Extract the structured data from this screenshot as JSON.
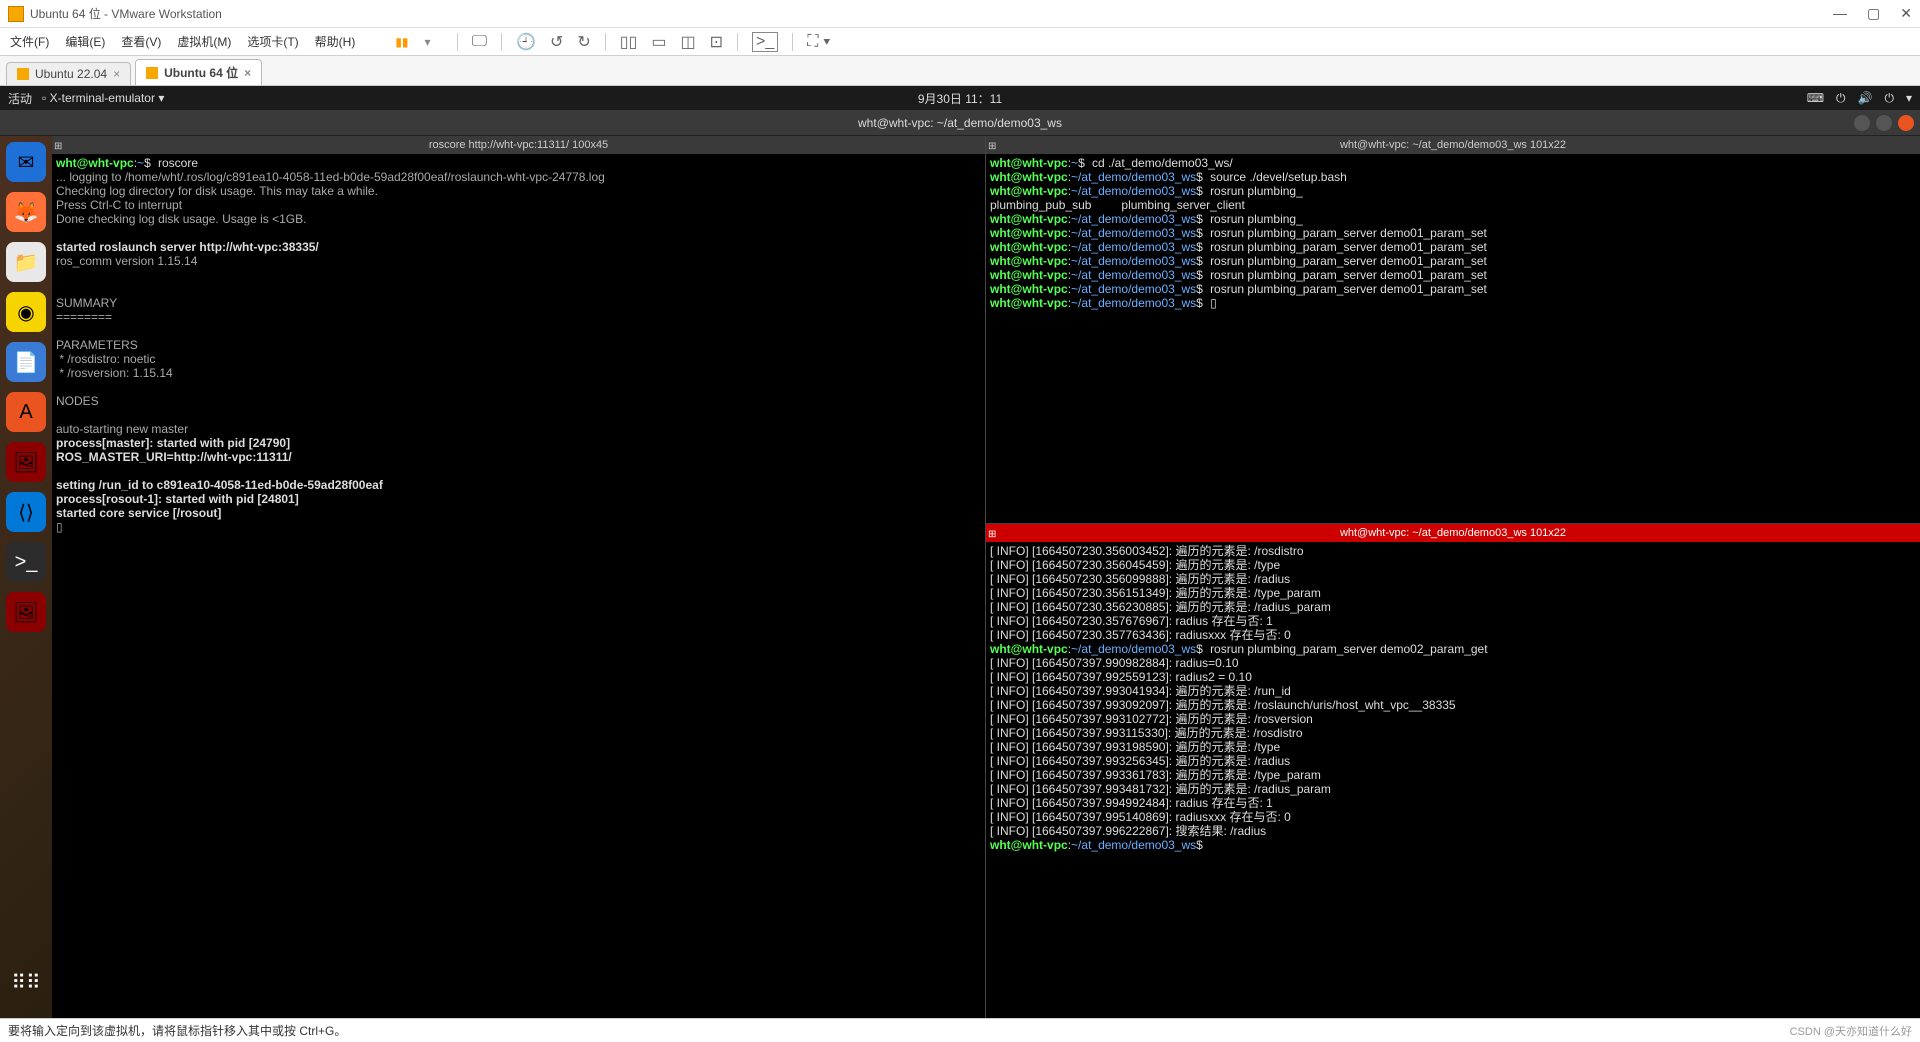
{
  "vmware": {
    "title": "Ubuntu 64 位 - VMware Workstation",
    "menus": [
      "文件(F)",
      "编辑(E)",
      "查看(V)",
      "虚拟机(M)",
      "选项卡(T)",
      "帮助(H)"
    ],
    "tabs": [
      {
        "label": "Ubuntu 22.04",
        "active": false
      },
      {
        "label": "Ubuntu 64 位",
        "active": true
      }
    ],
    "status": "要将输入定向到该虚拟机，请将鼠标指针移入其中或按 Ctrl+G。",
    "watermark": "CSDN @天亦知道什么好"
  },
  "ubuntu_top": {
    "activities": "活动",
    "app": "X-terminal-emulator",
    "clock": "9月30日 11：11"
  },
  "term_window_title": "wht@wht-vpc: ~/at_demo/demo03_ws",
  "pane_left": {
    "title": "roscore http://wht-vpc:11311/ 100x45",
    "lines": [
      {
        "p": "wht@wht-vpc",
        "path": "~",
        "cmd": "roscore"
      },
      "... logging to /home/wht/.ros/log/c891ea10-4058-11ed-b0de-59ad28f00eaf/roslaunch-wht-vpc-24778.log",
      "Checking log directory for disk usage. This may take a while.",
      "Press Ctrl-C to interrupt",
      "Done checking log disk usage. Usage is <1GB.",
      "",
      "started roslaunch server http://wht-vpc:38335/",
      "ros_comm version 1.15.14",
      "",
      "",
      "SUMMARY",
      "========",
      "",
      "PARAMETERS",
      " * /rosdistro: noetic",
      " * /rosversion: 1.15.14",
      "",
      "NODES",
      "",
      "auto-starting new master",
      "process[master]: started with pid [24790]",
      "ROS_MASTER_URI=http://wht-vpc:11311/",
      "",
      "setting /run_id to c891ea10-4058-11ed-b0de-59ad28f00eaf",
      "process[rosout-1]: started with pid [24801]",
      "started core service [/rosout]",
      "▯"
    ]
  },
  "pane_rt": {
    "title": "wht@wht-vpc: ~/at_demo/demo03_ws 101x22",
    "history": [
      {
        "p": "wht@wht-vpc",
        "path": "~",
        "cmd": "cd ./at_demo/demo03_ws/"
      },
      {
        "p": "wht@wht-vpc",
        "path": "~/at_demo/demo03_ws",
        "cmd": "source ./devel/setup.bash"
      },
      {
        "p": "wht@wht-vpc",
        "path": "~/at_demo/demo03_ws",
        "cmd": "rosrun plumbing_"
      }
    ],
    "completion": "plumbing_pub_sub         plumbing_server_client",
    "history2": [
      {
        "p": "wht@wht-vpc",
        "path": "~/at_demo/demo03_ws",
        "cmd": "rosrun plumbing_"
      },
      {
        "p": "wht@wht-vpc",
        "path": "~/at_demo/demo03_ws",
        "cmd": "rosrun plumbing_param_server demo01_param_set"
      },
      {
        "p": "wht@wht-vpc",
        "path": "~/at_demo/demo03_ws",
        "cmd": "rosrun plumbing_param_server demo01_param_set"
      },
      {
        "p": "wht@wht-vpc",
        "path": "~/at_demo/demo03_ws",
        "cmd": "rosrun plumbing_param_server demo01_param_set"
      },
      {
        "p": "wht@wht-vpc",
        "path": "~/at_demo/demo03_ws",
        "cmd": "rosrun plumbing_param_server demo01_param_set"
      },
      {
        "p": "wht@wht-vpc",
        "path": "~/at_demo/demo03_ws",
        "cmd": "rosrun plumbing_param_server demo01_param_set"
      },
      {
        "p": "wht@wht-vpc",
        "path": "~/at_demo/demo03_ws",
        "cmd": "▯"
      }
    ]
  },
  "pane_rb": {
    "title": "wht@wht-vpc: ~/at_demo/demo03_ws 101x22",
    "lines": [
      "[ INFO] [1664507230.356003452]: 遍历的元素是: /rosdistro",
      "[ INFO] [1664507230.356045459]: 遍历的元素是: /type",
      "[ INFO] [1664507230.356099888]: 遍历的元素是: /radius",
      "[ INFO] [1664507230.356151349]: 遍历的元素是: /type_param",
      "[ INFO] [1664507230.356230885]: 遍历的元素是: /radius_param",
      "[ INFO] [1664507230.357676967]: radius 存在与否: 1",
      "[ INFO] [1664507230.357763436]: radiusxxx 存在与否: 0"
    ],
    "prompt": {
      "p": "wht@wht-vpc",
      "path": "~/at_demo/demo03_ws",
      "cmd": "rosrun plumbing_param_server demo02_param_get"
    },
    "lines2": [
      "[ INFO] [1664507397.990982884]: radius=0.10",
      "[ INFO] [1664507397.992559123]: radius2 = 0.10",
      "[ INFO] [1664507397.993041934]: 遍历的元素是: /run_id",
      "[ INFO] [1664507397.993092097]: 遍历的元素是: /roslaunch/uris/host_wht_vpc__38335",
      "[ INFO] [1664507397.993102772]: 遍历的元素是: /rosversion",
      "[ INFO] [1664507397.993115330]: 遍历的元素是: /rosdistro",
      "[ INFO] [1664507397.993198590]: 遍历的元素是: /type",
      "[ INFO] [1664507397.993256345]: 遍历的元素是: /radius",
      "[ INFO] [1664507397.993361783]: 遍历的元素是: /type_param",
      "[ INFO] [1664507397.993481732]: 遍历的元素是: /radius_param",
      "[ INFO] [1664507397.994992484]: radius 存在与否: 1",
      "[ INFO] [1664507397.995140869]: radiusxxx 存在与否: 0",
      "[ INFO] [1664507397.996222867]: 搜索结果: /radius"
    ],
    "prompt2": {
      "p": "wht@wht-vpc",
      "path": "~/at_demo/demo03_ws",
      "cmd": ""
    }
  },
  "dock_icons": [
    "thunderbird",
    "firefox",
    "files",
    "rhythmbox",
    "libreoffice",
    "software",
    "screenshot",
    "vscode",
    "terminal",
    "screenshot2",
    "apps"
  ]
}
